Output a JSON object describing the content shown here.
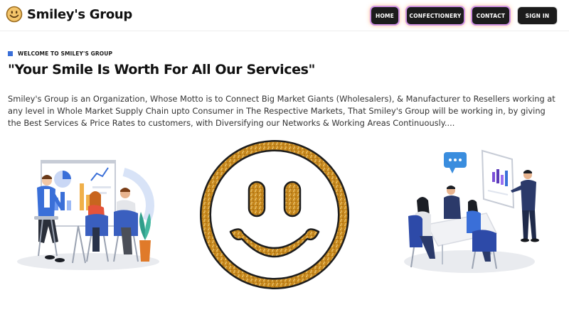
{
  "header": {
    "brand_name": "Smiley's Group",
    "brand_icon": "smiley-face-icon",
    "nav": [
      {
        "label": "HOME"
      },
      {
        "label": "CONFECTIONERY"
      },
      {
        "label": "CONTACT"
      },
      {
        "label": "SIGN IN"
      }
    ]
  },
  "hero": {
    "kicker": "WELCOME TO SMILEY'S GROUP",
    "headline": "\"Your Smile Is Worth For All Our Services\"",
    "intro": "Smiley's Group is an Organization, Whose Motto is to Connect Big Market Giants (Wholesalers), & Manufacturer to Resellers working at any level in Whole Market Supply Chain upto Consumer in The Respective Markets, That Smiley's Group will be working in, by giving the Best Services & Price Rates to customers, with Diversifying our Networks & Working Areas Continuously...."
  },
  "colors": {
    "accent_blue": "#3a6fd8",
    "nav_bg": "#1c1c1c",
    "nav_glow_purple": "#a85aff",
    "nav_glow_orange": "#ff8c46",
    "glitter_gold": "#c98a1e"
  },
  "illustrations": {
    "left": "business-presentation-illustration",
    "center": "glitter-smiley-face",
    "right": "team-meeting-illustration"
  }
}
